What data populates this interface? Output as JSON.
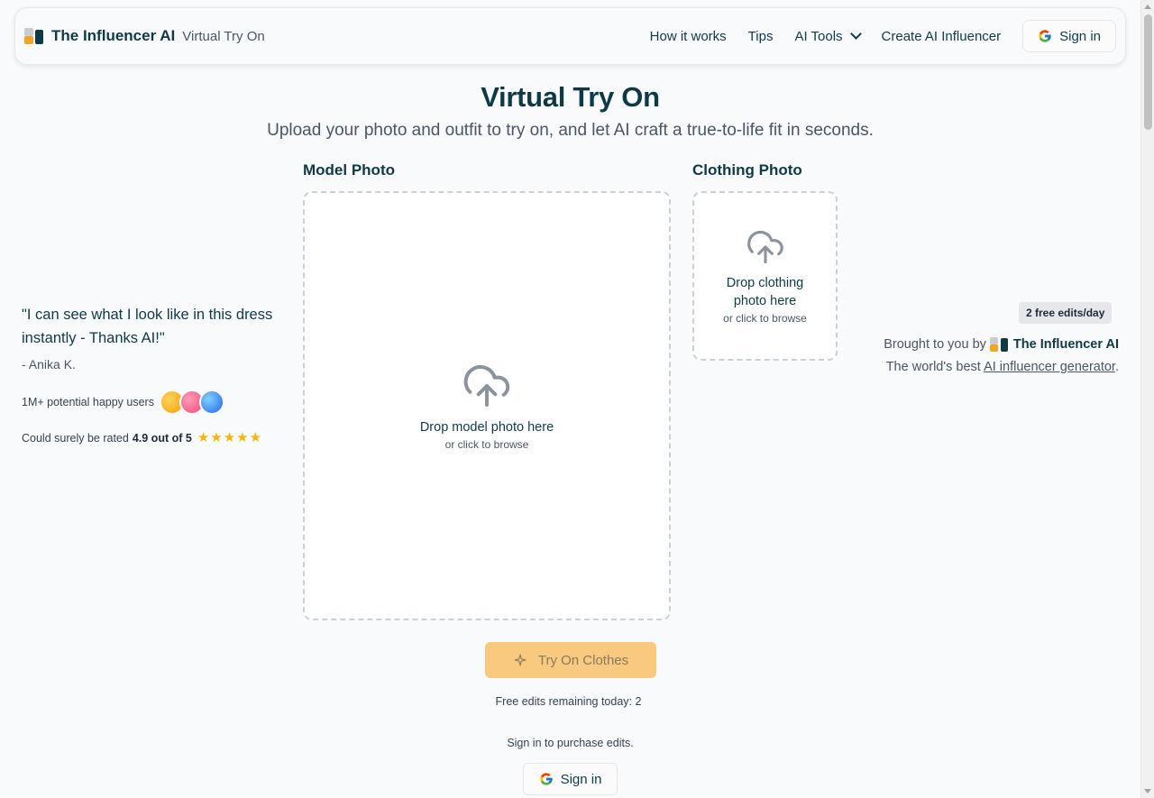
{
  "header": {
    "brand": "The Influencer AI",
    "brand_sub": "Virtual Try On",
    "nav": {
      "how_it_works": "How it works",
      "tips": "Tips",
      "ai_tools": "AI Tools",
      "create": "Create AI Influencer"
    },
    "signin_label": "Sign in"
  },
  "hero": {
    "title": "Virtual Try On",
    "subtitle": "Upload your photo and outfit to try on, and let AI craft a true-to-life fit in seconds."
  },
  "testimonial": {
    "quote": "\"I can see what I look like in this dress instantly - Thanks AI!\"",
    "author": "- Anika K.",
    "users_text": "1M+ potential happy users",
    "rating_prefix": "Could surely be rated",
    "rating_value": "4.9 out of 5",
    "stars": 5
  },
  "model_panel": {
    "label": "Model Photo",
    "drop_text": "Drop model photo here",
    "hint": "or click to browse"
  },
  "clothing_panel": {
    "label": "Clothing Photo",
    "drop_text": "Drop clothing photo here",
    "hint": "or click to browse"
  },
  "promo": {
    "badge": "2 free edits/day",
    "brought_by": "Brought to you by",
    "brand": "The Influencer AI",
    "worlds_prefix": "The world's best",
    "worlds_link": "AI influencer generator",
    "worlds_suffix": "."
  },
  "actions": {
    "try_on": "Try On Clothes",
    "free_remaining": "Free edits remaining today: 2",
    "signin_purchase": "Sign in to purchase edits.",
    "signin_label": "Sign in"
  },
  "colors": {
    "primary": "#0f3a45",
    "accent": "#f8c97e",
    "star": "#f5b50a"
  }
}
